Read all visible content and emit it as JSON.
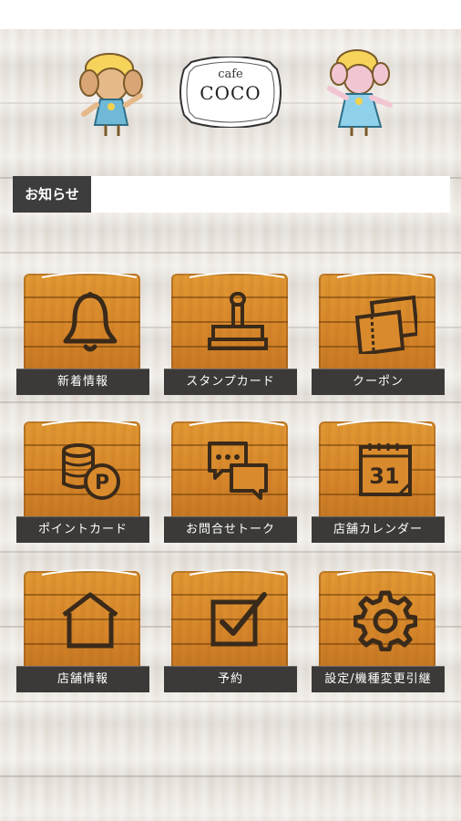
{
  "header": {
    "logo_small": "cafe",
    "logo_main": "COCO"
  },
  "notice": {
    "label": "お知らせ",
    "text": ""
  },
  "menu": [
    {
      "label": "新着情報",
      "icon": "bell-icon"
    },
    {
      "label": "スタンプカード",
      "icon": "stamp-icon"
    },
    {
      "label": "クーポン",
      "icon": "coupon-icon"
    },
    {
      "label": "ポイントカード",
      "icon": "points-coins-icon"
    },
    {
      "label": "お問合せトーク",
      "icon": "chat-bubbles-icon"
    },
    {
      "label": "店舗カレンダー",
      "icon": "calendar-icon",
      "calendar_day": "31"
    },
    {
      "label": "店舗情報",
      "icon": "store-house-icon"
    },
    {
      "label": "予約",
      "icon": "checkbox-icon"
    },
    {
      "label": "設定/機種変更引継",
      "icon": "gear-icon"
    }
  ],
  "colors": {
    "board": "#d98a2c",
    "label_bg": "#3b3a38",
    "notice_label_bg": "#3d3d3d"
  }
}
